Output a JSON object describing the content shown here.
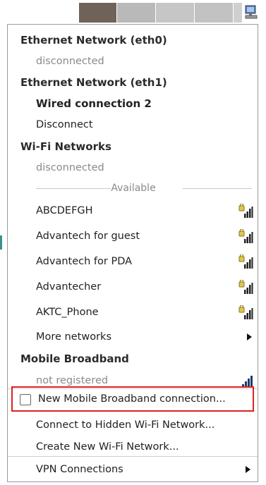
{
  "panel": {
    "segments": [
      {
        "color": "#6f6259"
      },
      {
        "color": "#b9b9b9"
      },
      {
        "color": "#c6c6c6"
      },
      {
        "color": "#c2c2c2"
      },
      {
        "color": "#cfcfcf"
      }
    ],
    "tray_icon": "network-computer-icon"
  },
  "menu": {
    "eth0": {
      "header": "Ethernet Network (eth0)",
      "status": "disconnected"
    },
    "eth1": {
      "header": "Ethernet Network (eth1)",
      "connection": "Wired connection 2",
      "action": "Disconnect"
    },
    "wifi": {
      "header": "Wi-Fi Networks",
      "status": "disconnected",
      "available_label": "Available",
      "networks": [
        {
          "ssid": "ABCDEFGH",
          "icon": "locked-signal-icon"
        },
        {
          "ssid": "Advantech for guest",
          "icon": "locked-signal-icon"
        },
        {
          "ssid": "Advantech for PDA",
          "icon": "locked-signal-icon"
        },
        {
          "ssid": "Advantecher",
          "icon": "locked-signal-icon"
        },
        {
          "ssid": "AKTC_Phone",
          "icon": "locked-signal-icon"
        }
      ],
      "more": "More networks"
    },
    "mobile": {
      "header": "Mobile Broadband",
      "status": "not registered",
      "new_connection": "New Mobile Broadband connection..."
    },
    "actions": {
      "hidden": "Connect to Hidden Wi-Fi Network...",
      "create": "Create New Wi-Fi Network...",
      "vpn": "VPN Connections"
    }
  },
  "colors": {
    "highlight_border": "#e02020",
    "signal": "#222222",
    "lock": "#e3c74a"
  }
}
